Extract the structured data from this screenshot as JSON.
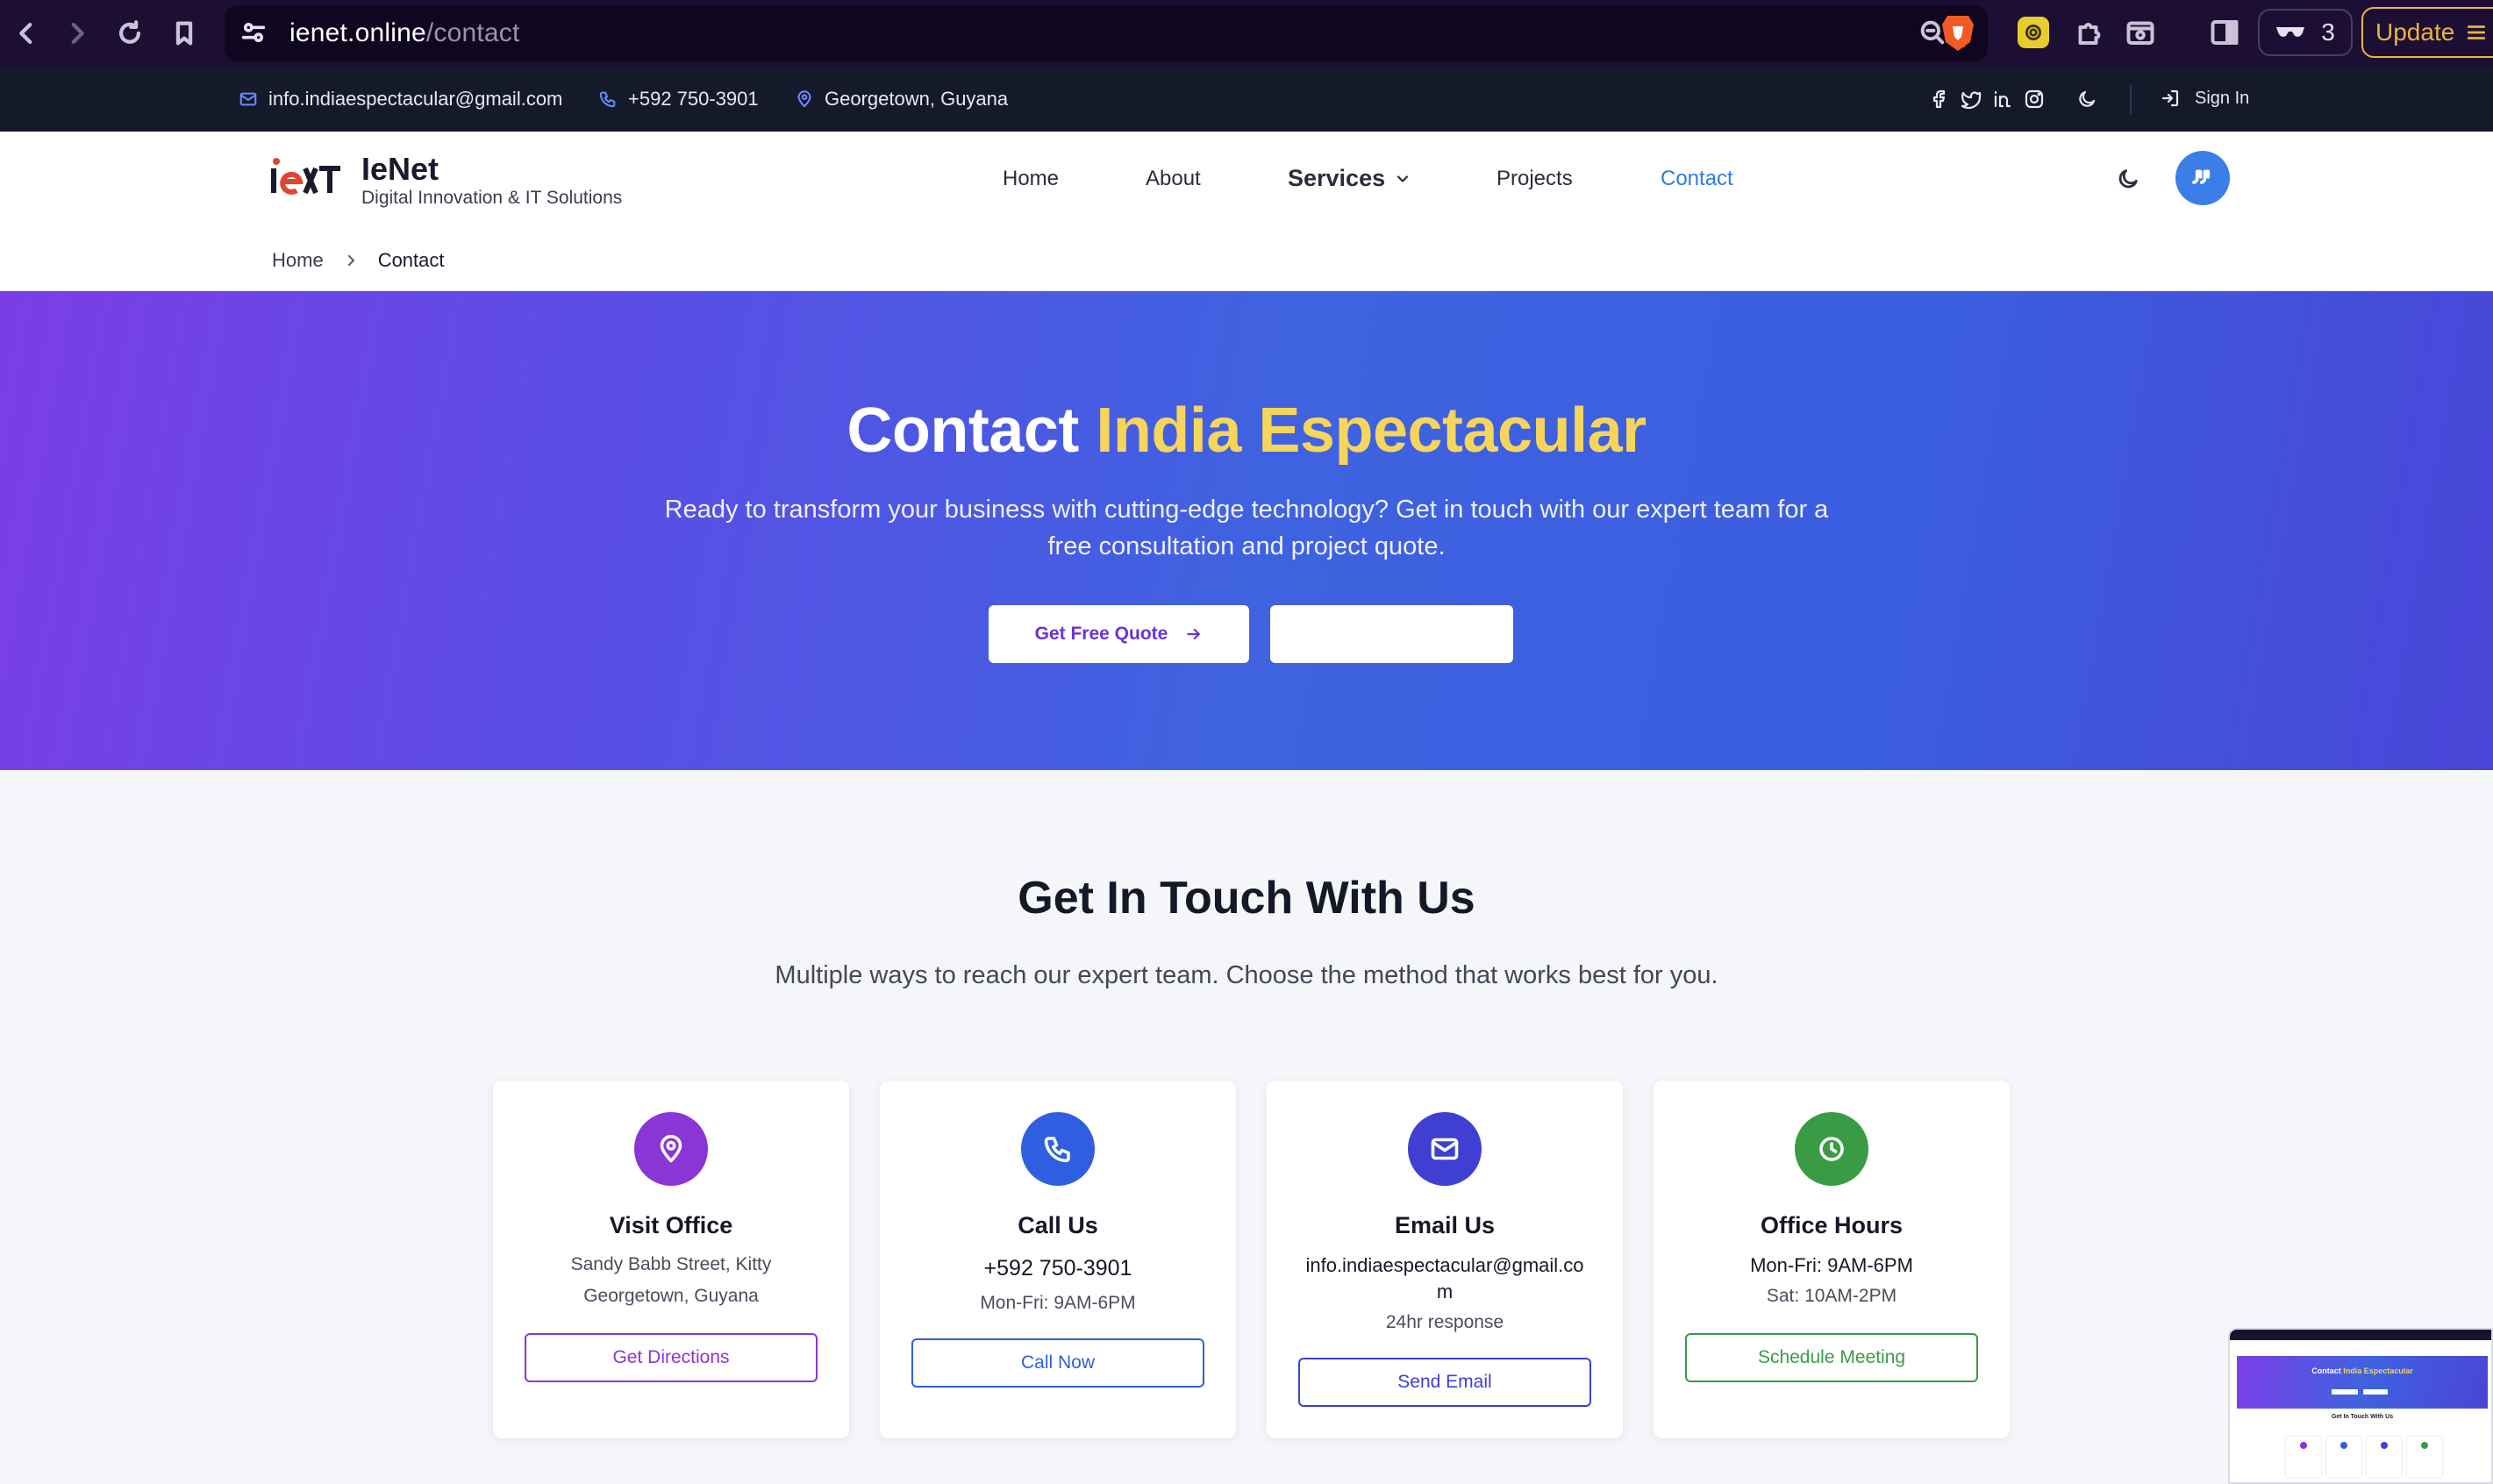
{
  "browser": {
    "url_host": "ienet.online",
    "url_path": "/contact",
    "wallet_count": "3",
    "update_label": "Update"
  },
  "topbar": {
    "email": "info.indiaespectacular@gmail.com",
    "phone": "+592 750-3901",
    "location": "Georgetown, Guyana",
    "signin_label": "Sign In"
  },
  "header": {
    "brand_name": "IeNet",
    "brand_tagline": "Digital Innovation & IT Solutions",
    "nav": {
      "home": "Home",
      "about": "About",
      "services": "Services",
      "projects": "Projects",
      "contact": "Contact"
    },
    "breadcrumb": {
      "home": "Home",
      "current": "Contact"
    }
  },
  "hero": {
    "title_prefix": "Contact",
    "title_accent": "India Espectacular",
    "subtitle": "Ready to transform your business with cutting-edge technology? Get in touch with our expert team for a free consultation and project quote.",
    "quote_button": "Get Free Quote"
  },
  "touch": {
    "title": "Get In Touch With Us",
    "subtitle": "Multiple ways to reach our expert team. Choose the method that works best for you.",
    "cards": [
      {
        "title": "Visit Office",
        "line1": "Sandy Babb Street, Kitty",
        "line2": "Georgetown, Guyana",
        "cta": "Get Directions",
        "color": "#8a35d6"
      },
      {
        "title": "Call Us",
        "line1": "+592 750-3901",
        "line2": "Mon-Fri: 9AM-6PM",
        "cta": "Call Now",
        "color": "#2f5fe0"
      },
      {
        "title": "Email Us",
        "line1a": "info.indiaespectacular@gmail.co",
        "line1b": "m",
        "line2": "24hr response",
        "cta": "Send Email",
        "color": "#3f3fd4"
      },
      {
        "title": "Office Hours",
        "line1": "Mon-Fri: 9AM-6PM",
        "line2": "Sat: 10AM-2PM",
        "cta": "Schedule Meeting",
        "color": "#3a9b45"
      }
    ]
  }
}
